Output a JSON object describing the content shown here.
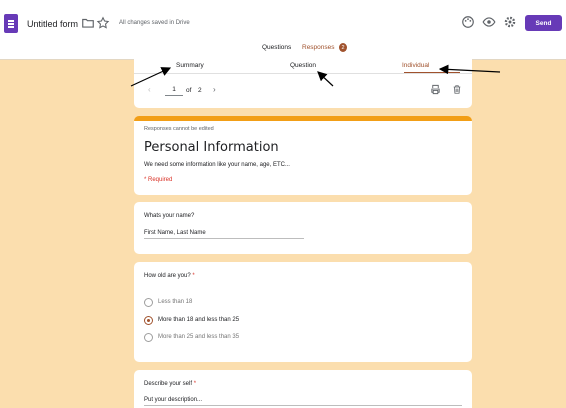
{
  "header": {
    "title": "Untitled form",
    "saved_status": "All changes saved in Drive",
    "send_label": "Send",
    "icons": [
      "forms-app-icon",
      "folder-icon",
      "star-icon",
      "palette-icon",
      "preview-eye-icon",
      "settings-gear-icon"
    ]
  },
  "tabs": {
    "questions": "Questions",
    "responses": "Responses",
    "responses_count": "2"
  },
  "response_nav": {
    "summary": "Summary",
    "question": "Question",
    "individual": "Individual",
    "current": "1",
    "of": "of",
    "total": "2",
    "prev_icon": "chevron-left-icon",
    "next_icon": "chevron-right-icon"
  },
  "info": {
    "notice": "Responses cannot be edited",
    "title": "Personal Information",
    "description": "We need some information like your name, age, ETC...",
    "required_note": "* Required"
  },
  "questions": {
    "name": {
      "label": "Whats your name?",
      "answer": "First Name, Last Name"
    },
    "age": {
      "label": "How old are you?",
      "required_mark": "*",
      "options": [
        "Less than 18",
        "More than 18 and less than 25",
        "More than 25 and less than 35"
      ],
      "selected": "More than 18 and less than 25"
    },
    "self": {
      "label": "Describe your self",
      "required_mark": "*",
      "answer": "Put your description..."
    }
  },
  "colors": {
    "background": "#fbdeae",
    "accent": "#a0522d",
    "brand": "#673ab7",
    "header_bar": "#f29e16",
    "required": "#d93025"
  }
}
